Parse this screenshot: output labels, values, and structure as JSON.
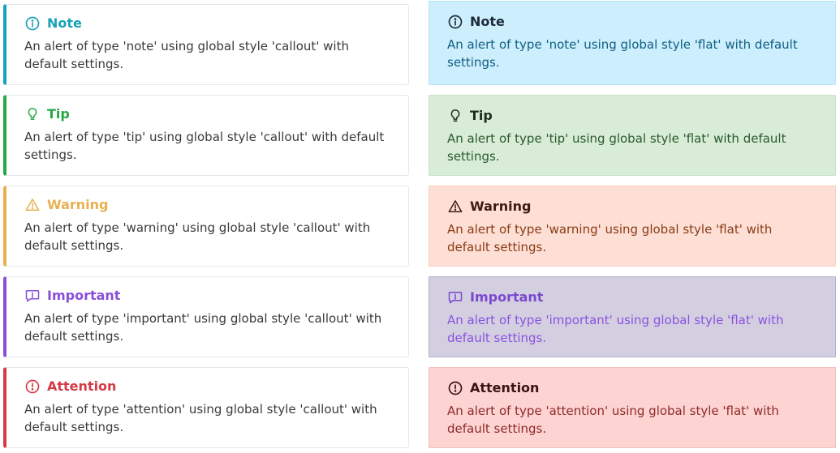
{
  "callout": [
    {
      "type": "note",
      "title": "Note",
      "icon": "info-circle-icon",
      "color": "#17a2b8",
      "body": "An alert of type 'note' using global style 'callout' with default settings."
    },
    {
      "type": "tip",
      "title": "Tip",
      "icon": "lightbulb-icon",
      "color": "#28a745",
      "body": "An alert of type 'tip' using global style 'callout' with default settings."
    },
    {
      "type": "warning",
      "title": "Warning",
      "icon": "warning-triangle-icon",
      "color": "#e9b051",
      "body": "An alert of type 'warning' using global style 'callout' with default settings."
    },
    {
      "type": "important",
      "title": "Important",
      "icon": "message-alert-icon",
      "color": "#8a4fd9",
      "body": "An alert of type 'important' using global style 'callout' with default settings."
    },
    {
      "type": "attention",
      "title": "Attention",
      "icon": "alert-circle-icon",
      "color": "#d63a44",
      "body": "An alert of type 'attention' using global style 'callout' with default settings."
    }
  ],
  "flat": [
    {
      "type": "note",
      "title": "Note",
      "icon": "info-circle-icon",
      "bg": "#cdeefd",
      "border": "#b6e4f8",
      "title_color": "#1c2a36",
      "text_color": "#0f5f82",
      "body": "An alert of type 'note' using global style 'flat' with default settings."
    },
    {
      "type": "tip",
      "title": "Tip",
      "icon": "lightbulb-icon",
      "bg": "#d8ecd7",
      "border": "#c6e2c5",
      "title_color": "#1b2d1b",
      "text_color": "#2b5a2c",
      "body": "An alert of type 'tip' using global style 'flat' with default settings."
    },
    {
      "type": "warning",
      "title": "Warning",
      "icon": "warning-triangle-icon",
      "bg": "#fddfd6",
      "border": "#f6cfc2",
      "title_color": "#3a1d10",
      "text_color": "#8a3b13",
      "body": "An alert of type 'warning' using global style 'flat' with default settings."
    },
    {
      "type": "important",
      "title": "Important",
      "icon": "message-alert-icon",
      "bg": "#d4cfe0",
      "border": "#b6b0c8",
      "title_color": "#7a48d0",
      "text_color": "#8a52e0",
      "body": "An alert of type 'important' using global style 'flat' with default settings."
    },
    {
      "type": "attention",
      "title": "Attention",
      "icon": "alert-circle-icon",
      "bg": "#fdd4d2",
      "border": "#f5c0bd",
      "title_color": "#3a1414",
      "text_color": "#8e2a2a",
      "body": "An alert of type 'attention' using global style 'flat' with default settings."
    }
  ]
}
